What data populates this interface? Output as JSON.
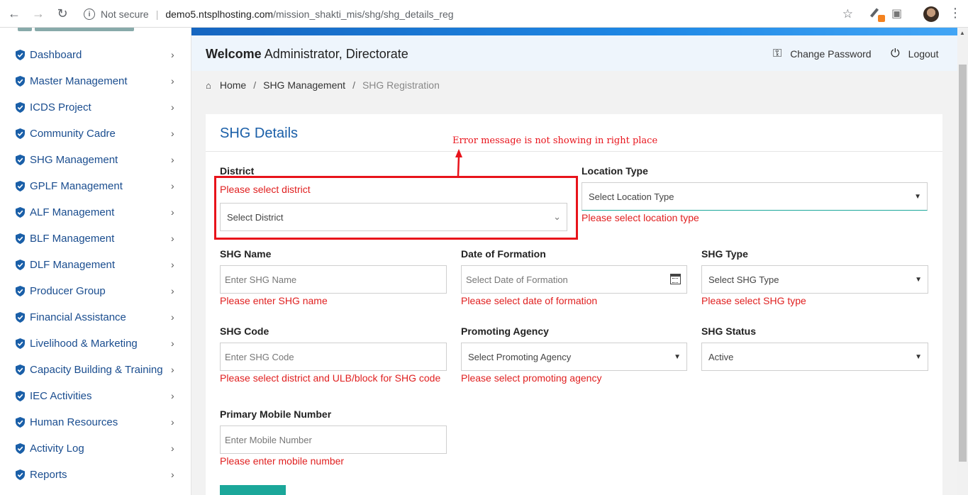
{
  "browser": {
    "not_secure": "Not secure",
    "host": "demo5.ntsplhosting.com",
    "path": "/mission_shakti_mis/shg/shg_details_reg"
  },
  "sidebar": {
    "items": [
      {
        "label": "Dashboard"
      },
      {
        "label": "Master Management"
      },
      {
        "label": "ICDS Project"
      },
      {
        "label": "Community Cadre"
      },
      {
        "label": "SHG Management"
      },
      {
        "label": "GPLF Management"
      },
      {
        "label": "ALF Management"
      },
      {
        "label": "BLF Management"
      },
      {
        "label": "DLF Management"
      },
      {
        "label": "Producer Group"
      },
      {
        "label": "Financial Assistance"
      },
      {
        "label": "Livelihood & Marketing"
      },
      {
        "label": "Capacity Building & Training"
      },
      {
        "label": "IEC Activities"
      },
      {
        "label": "Human Resources"
      },
      {
        "label": "Activity Log"
      },
      {
        "label": "Reports"
      }
    ]
  },
  "header": {
    "welcome_prefix": "Welcome",
    "welcome_user": "Administrator, Directorate",
    "change_password": "Change Password",
    "logout": "Logout"
  },
  "breadcrumb": {
    "home": "Home",
    "section": "SHG Management",
    "current": "SHG Registration"
  },
  "card": {
    "title": "SHG Details"
  },
  "form": {
    "district": {
      "label": "District",
      "value": "Select District",
      "error": "Please select district"
    },
    "location_type": {
      "label": "Location Type",
      "value": "Select Location Type",
      "error": "Please select location type"
    },
    "shg_name": {
      "label": "SHG Name",
      "placeholder": "Enter SHG Name",
      "error": "Please enter SHG name"
    },
    "date_of_formation": {
      "label": "Date of Formation",
      "placeholder": "Select Date of Formation",
      "error": "Please select date of formation"
    },
    "shg_type": {
      "label": "SHG Type",
      "value": "Select SHG Type",
      "error": "Please select SHG type"
    },
    "shg_code": {
      "label": "SHG Code",
      "placeholder": "Enter SHG Code",
      "error": "Please select district and ULB/block for SHG code"
    },
    "promoting_agency": {
      "label": "Promoting Agency",
      "value": "Select Promoting Agency",
      "error": "Please select promoting agency"
    },
    "shg_status": {
      "label": "SHG Status",
      "value": "Active"
    },
    "mobile": {
      "label": "Primary Mobile Number",
      "placeholder": "Enter Mobile Number",
      "error": "Please enter mobile number"
    }
  },
  "annotation": {
    "text": "Error message is not showing in right place",
    "color": "#e8131b"
  }
}
